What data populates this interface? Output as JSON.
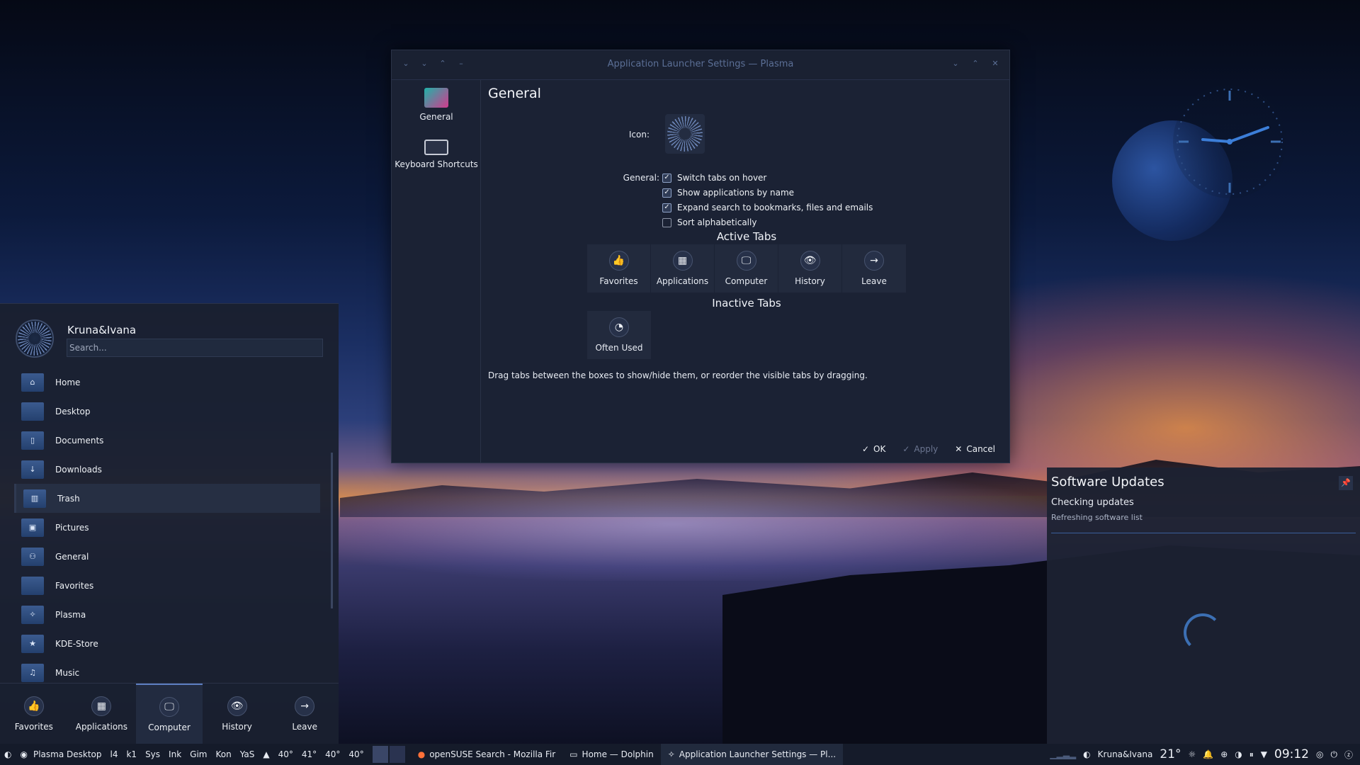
{
  "window": {
    "title": "Application Launcher Settings — Plasma",
    "nav": [
      {
        "label": "General"
      },
      {
        "label": "Keyboard Shortcuts"
      }
    ],
    "page_title": "General",
    "icon_label": "Icon:",
    "general_label": "General:",
    "options": [
      {
        "label": "Switch tabs on hover",
        "checked": true
      },
      {
        "label": "Show applications by name",
        "checked": true
      },
      {
        "label": "Expand search to bookmarks, files and emails",
        "checked": true
      },
      {
        "label": "Sort alphabetically",
        "checked": false
      }
    ],
    "active_tabs_title": "Active Tabs",
    "active_tabs": [
      {
        "label": "Favorites",
        "icon": "thumbs-up-icon",
        "glyph": "👍"
      },
      {
        "label": "Applications",
        "icon": "apps-icon",
        "glyph": "▦"
      },
      {
        "label": "Computer",
        "icon": "computer-icon",
        "glyph": "🖵"
      },
      {
        "label": "History",
        "icon": "eye-icon",
        "glyph": "👁"
      },
      {
        "label": "Leave",
        "icon": "arrow-right-icon",
        "glyph": "→"
      }
    ],
    "inactive_tabs_title": "Inactive Tabs",
    "inactive_tabs": [
      {
        "label": "Often Used",
        "icon": "pie-icon",
        "glyph": "◔"
      }
    ],
    "hint": "Drag tabs between the boxes to show/hide them, or reorder the visible tabs by dragging.",
    "buttons": {
      "ok": "OK",
      "apply": "Apply",
      "cancel": "Cancel"
    }
  },
  "kickoff": {
    "user": "Kruna&Ivana",
    "search_placeholder": "Search...",
    "items": [
      {
        "label": "Home",
        "glyph": "⌂"
      },
      {
        "label": "Desktop",
        "glyph": ""
      },
      {
        "label": "Documents",
        "glyph": "▯"
      },
      {
        "label": "Downloads",
        "glyph": "↓"
      },
      {
        "label": "Trash",
        "glyph": "▥"
      },
      {
        "label": "Pictures",
        "glyph": "▣"
      },
      {
        "label": "General",
        "glyph": "⚇"
      },
      {
        "label": "Favorites",
        "glyph": ""
      },
      {
        "label": "Plasma",
        "glyph": "✧"
      },
      {
        "label": "KDE-Store",
        "glyph": "★"
      },
      {
        "label": "Music",
        "glyph": "♫"
      }
    ],
    "tabs": [
      {
        "label": "Favorites",
        "glyph": "👍"
      },
      {
        "label": "Applications",
        "glyph": "▦"
      },
      {
        "label": "Computer",
        "glyph": "🖵"
      },
      {
        "label": "History",
        "glyph": "👁"
      },
      {
        "label": "Leave",
        "glyph": "→"
      }
    ]
  },
  "updates": {
    "title": "Software Updates",
    "status": "Checking updates",
    "detail": "Refreshing software list"
  },
  "taskbar": {
    "activity": "Plasma Desktop",
    "launchers": [
      "l4",
      "k1",
      "Sys",
      "Ink",
      "Gim",
      "Kon",
      "YaS"
    ],
    "temps": [
      "40°",
      "41°",
      "40°",
      "40°"
    ],
    "tasks": [
      {
        "label": "openSUSE Search - Mozilla Fir"
      },
      {
        "label": "Home — Dolphin"
      },
      {
        "label": "Application Launcher Settings — Pl..."
      }
    ],
    "user": "Kruna&Ivana",
    "weather_temp": "21°",
    "time": "09:12"
  },
  "colors": {
    "accent": "#3c6fb3",
    "window_bg": "#1b2234",
    "panel_bg": "#151b2a"
  }
}
